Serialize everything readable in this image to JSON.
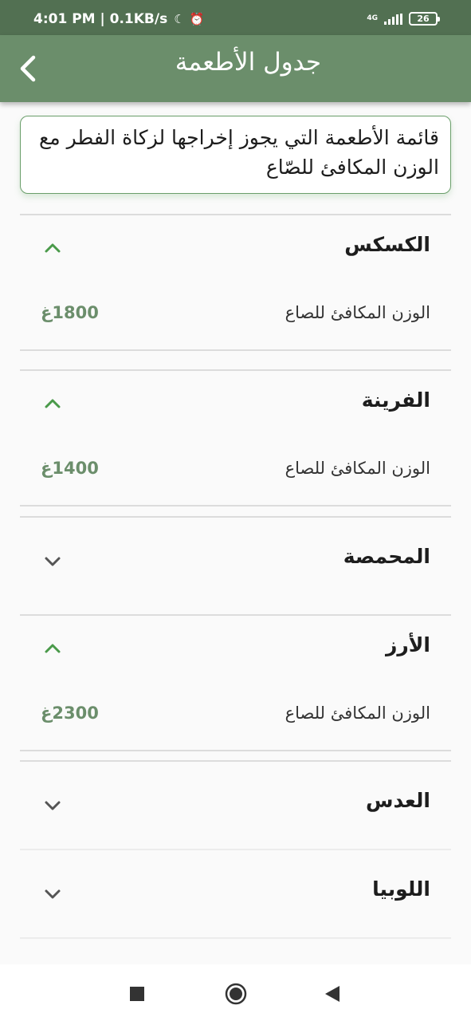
{
  "status_bar": {
    "time_text": "4:01 PM | 0.1KB/s",
    "network": "4G",
    "battery": "26",
    "icons": [
      "moon-icon",
      "alarm-icon",
      "signal-icon",
      "battery-icon"
    ]
  },
  "app_bar": {
    "title": "جدول الأطعمة",
    "back_icon": "chevron-left-icon"
  },
  "description": "قائمة الأطعمة التي يجوز إخراجها لزكاة الفطر مع الوزن المكافئ للصّاع",
  "colors": {
    "status_bar": "#527052",
    "app_bar": "#6b8e6b",
    "accent": "#6b8e6b",
    "chevron_expanded": "#4a9a4a",
    "chevron_collapsed": "#555555"
  },
  "foods": [
    {
      "name": "الكسكس",
      "expanded": true,
      "weight_label": "الوزن المكافئ للصاع",
      "weight_value": "1800غ"
    },
    {
      "name": "الفرينة",
      "expanded": true,
      "weight_label": "الوزن المكافئ للصاع",
      "weight_value": "1400غ"
    },
    {
      "name": "المحمصة",
      "expanded": false
    },
    {
      "name": "الأرز",
      "expanded": true,
      "weight_label": "الوزن المكافئ للصاع",
      "weight_value": "2300غ"
    },
    {
      "name": "العدس",
      "expanded": false
    },
    {
      "name": "اللوبيا",
      "expanded": false
    }
  ],
  "nav_bar": {
    "icons": [
      "recents-icon",
      "home-icon",
      "back-icon"
    ]
  }
}
